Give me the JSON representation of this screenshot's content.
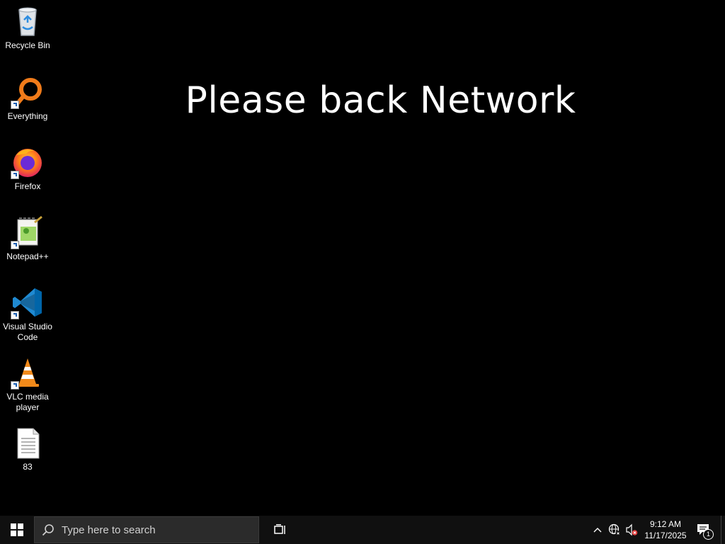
{
  "desktop": {
    "wallpaper_text": "Please back Network",
    "icons": [
      {
        "label": "Recycle Bin",
        "icon": "recycle-bin-icon"
      },
      {
        "label": "Everything",
        "icon": "everything-search-icon"
      },
      {
        "label": "Firefox",
        "icon": "firefox-icon"
      },
      {
        "label": "Notepad++",
        "icon": "notepad-plus-plus-icon"
      },
      {
        "label": "Visual Studio Code",
        "icon": "vscode-icon"
      },
      {
        "label": "VLC media player",
        "icon": "vlc-icon"
      },
      {
        "label": "83",
        "icon": "text-file-icon"
      }
    ]
  },
  "taskbar": {
    "search_placeholder": "Type here to search",
    "clock_time": "9:12 AM",
    "clock_date": "11/17/2025",
    "notification_count": "1"
  }
}
